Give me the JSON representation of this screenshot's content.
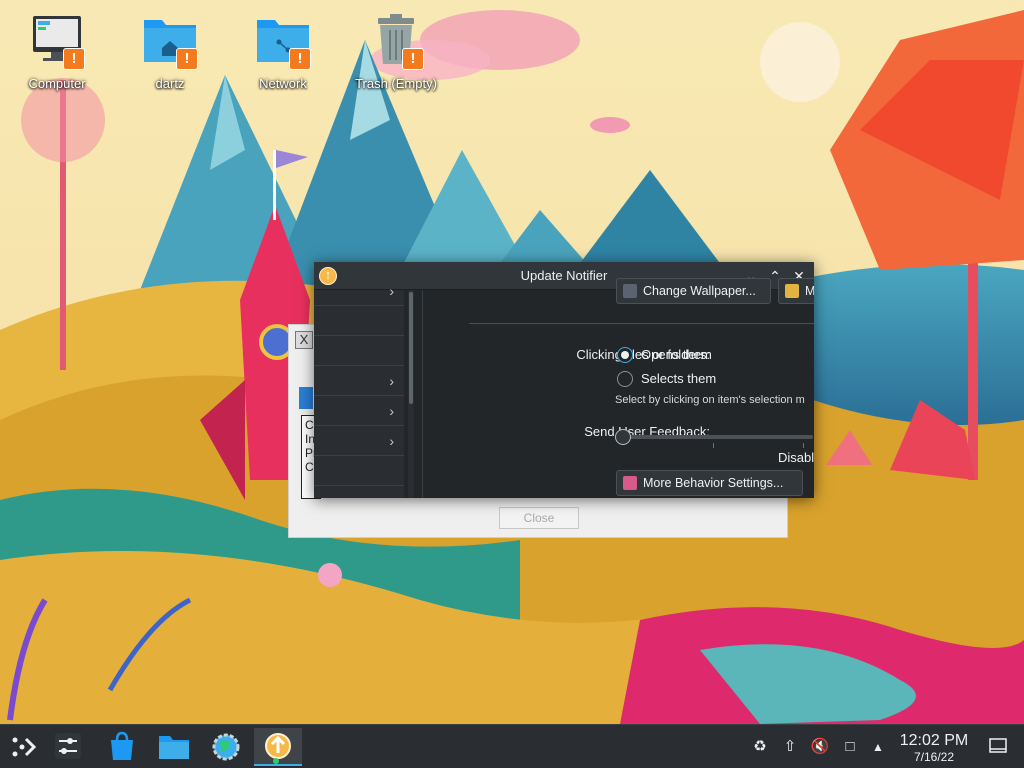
{
  "desktop": {
    "icons": [
      {
        "label": "Computer"
      },
      {
        "label": "dartz"
      },
      {
        "label": "Network"
      },
      {
        "label": "Trash (Empty)"
      }
    ],
    "badge_symbol": "!"
  },
  "background_dialog": {
    "close_label": "Close",
    "text_lines": [
      "Co",
      "In",
      "Pr",
      "Co"
    ]
  },
  "notifier": {
    "title": "Update Notifier",
    "change_wallpaper_label": "Change Wallpaper...",
    "partial_button_label": "M",
    "clicking_label": "Clicking files or folders:",
    "option_open": "Opens them",
    "option_select": "Selects them",
    "select_hint": "Select by clicking on item's selection m",
    "feedback_label": "Send User Feedback:",
    "slider_value_label": "Disabl",
    "more_behavior_label": "More Behavior Settings...",
    "selected_option": "open"
  },
  "taskbar": {
    "time": "12:02 PM",
    "date": "7/16/22"
  },
  "colors": {
    "accent": "#3daee9",
    "badge": "#f47a1e",
    "window_bg": "#232629",
    "titlebar": "#31363b",
    "taskbar": "#2a2e32"
  }
}
